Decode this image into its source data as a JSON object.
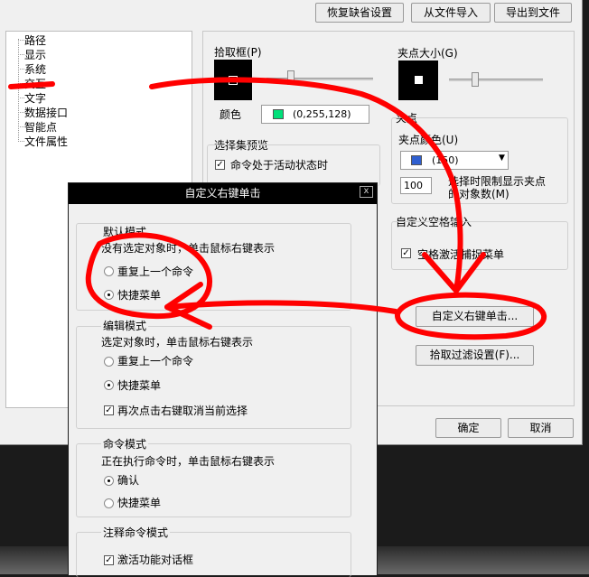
{
  "toolbar": {
    "restore_defaults": "恢复缺省设置",
    "import_from_file": "从文件导入",
    "export_to_file": "导出到文件"
  },
  "tree": {
    "items": [
      "路径",
      "显示",
      "系统",
      "交互",
      "文字",
      "数据接口",
      "智能点",
      "文件属性"
    ]
  },
  "pickbox": {
    "title": "拾取框(P)",
    "color_label": "颜色",
    "color_value": "(0,255,128)",
    "color_swatch": "#00e07a"
  },
  "selection_preview": {
    "title": "选择集预览",
    "active_command": "命令处于活动状态时"
  },
  "grip": {
    "size_title": "夹点大小(G)",
    "group_title": "夹点",
    "color_label": "夹点颜色(U)",
    "color_value": "(150)",
    "color_swatch": "#2f5fd0",
    "limit_value": "100",
    "limit_text_1": "选择时限制显示夹点",
    "limit_text_2": "的对象数(M)"
  },
  "custom_space": {
    "title": "自定义空格输入",
    "checkbox": "空格激活捕捉菜单"
  },
  "custom_right_click_btn": "自定义右键单击...",
  "pick_filter_btn": "拾取过滤设置(F)...",
  "ok": "确定",
  "cancel": "取消",
  "dialog": {
    "title": "自定义右键单击",
    "close": "x",
    "default_mode": {
      "title": "默认模式",
      "desc": "没有选定对象时，单击鼠标右键表示",
      "opt1": "重复上一个命令",
      "opt2": "快捷菜单",
      "selected": 2
    },
    "edit_mode": {
      "title": "编辑模式",
      "desc": "选定对象时，单击鼠标右键表示",
      "opt1": "重复上一个命令",
      "opt2": "快捷菜单",
      "selected": 2,
      "checkbox": "再次点击右键取消当前选择"
    },
    "command_mode": {
      "title": "命令模式",
      "desc": "正在执行命令时，单击鼠标右键表示",
      "opt1": "确认",
      "opt2": "快捷菜单",
      "selected": 1
    },
    "annotation_mode": {
      "title": "注释命令模式",
      "checkbox": "激活功能对话框"
    }
  },
  "annotation_color": "#ff0000"
}
